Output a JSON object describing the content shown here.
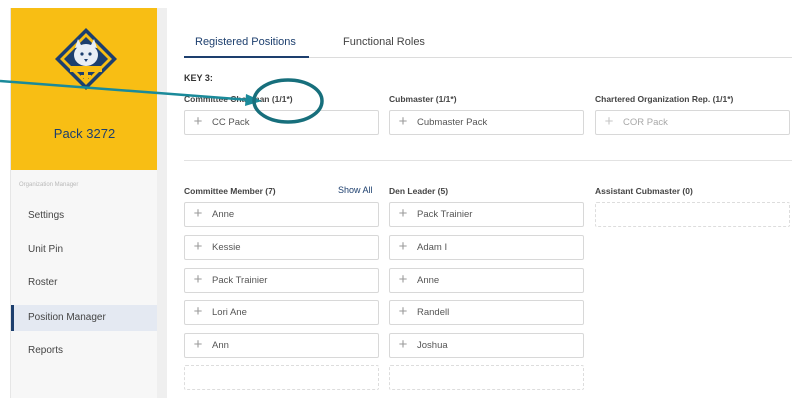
{
  "sidebar": {
    "pack_name": "Pack 3272",
    "org_label": "Organization Manager",
    "items": [
      {
        "label": "Settings"
      },
      {
        "label": "Unit Pin"
      },
      {
        "label": "Roster"
      },
      {
        "label": "Position Manager",
        "active": true
      },
      {
        "label": "Reports"
      }
    ]
  },
  "tabs": [
    {
      "label": "Registered Positions",
      "active": true
    },
    {
      "label": "Functional Roles"
    }
  ],
  "key_label": "KEY 3:",
  "key3": {
    "committee_chairman": {
      "heading": "Committee Chairman (1/1*)",
      "slot": "CC Pack"
    },
    "cubmaster": {
      "heading": "Cubmaster (1/1*)",
      "slot": "Cubmaster Pack"
    },
    "chartered_org_rep": {
      "heading": "Chartered Organization Rep. (1/1*)",
      "slot": "COR Pack"
    }
  },
  "committee_member": {
    "heading": "Committee Member (7)",
    "show_all": "Show All",
    "slots": [
      "Anne",
      "Kessie",
      "Pack Trainier",
      "Lori Ane",
      "Ann"
    ]
  },
  "den_leader": {
    "heading": "Den Leader (5)",
    "slots": [
      "Pack Trainier",
      "Adam I",
      "Anne",
      "Randell",
      "Joshua"
    ]
  },
  "assistant_cubmaster": {
    "heading": "Assistant Cubmaster (0)"
  },
  "colors": {
    "brand_yellow": "#f8be14",
    "navy": "#1d3f6e",
    "annotation_teal": "#1a8a9a"
  },
  "icons": [
    "cub-scout-logo-icon",
    "plus-icon"
  ]
}
